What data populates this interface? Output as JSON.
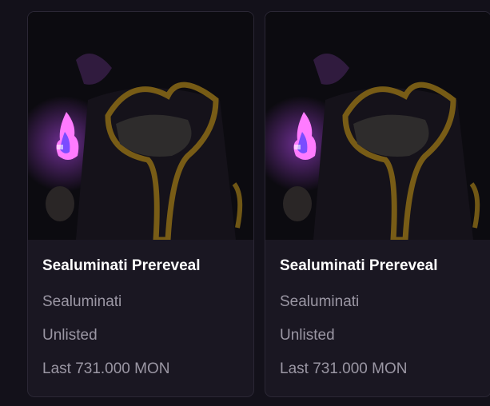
{
  "colors": {
    "page_bg": "#13111a",
    "card_bg": "#1a1722",
    "card_border": "#2b2735",
    "title": "#ffffff",
    "meta": "#9b97a4",
    "flame": "#d24bff",
    "robe": "#b8901e"
  },
  "cards": [
    {
      "image_icon": "hooded-figure-image",
      "title": "Sealuminati Prereveal",
      "collection": "Sealuminati",
      "status": "Unlisted",
      "last_sale": "Last 731.000 MON"
    },
    {
      "image_icon": "hooded-figure-image",
      "title": "Sealuminati Prereveal",
      "collection": "Sealuminati",
      "status": "Unlisted",
      "last_sale": "Last 731.000 MON"
    }
  ]
}
